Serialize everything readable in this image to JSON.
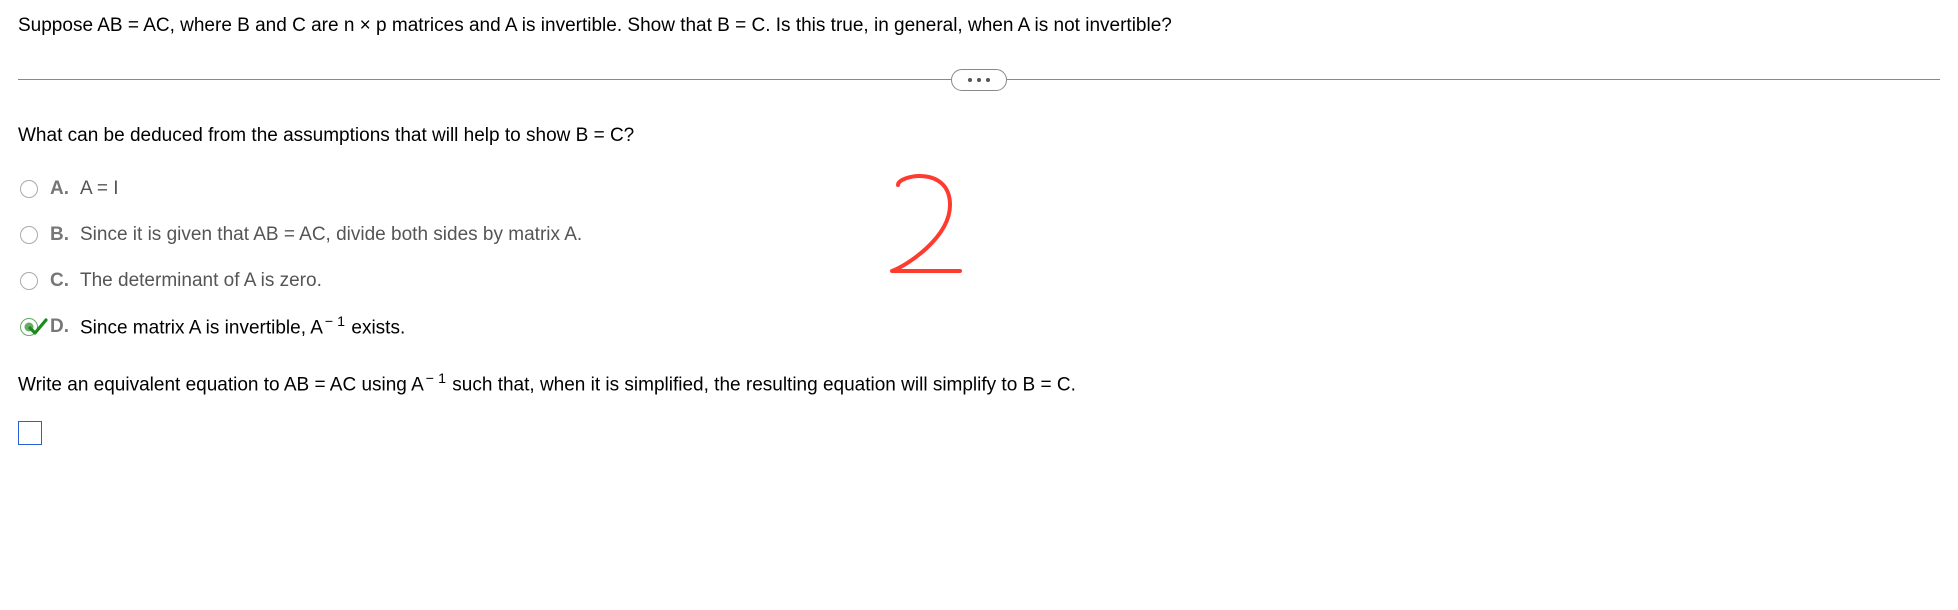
{
  "problem": "Suppose AB = AC, where B and C are n × p matrices and A is invertible. Show that B = C. Is this true, in general, when A is not invertible?",
  "question": "What can be deduced from the assumptions that will help to show B = C?",
  "options": {
    "a": {
      "letter": "A.",
      "text": "A = I"
    },
    "b": {
      "letter": "B.",
      "text": "Since it is given that AB = AC, divide both sides by matrix A."
    },
    "c": {
      "letter": "C.",
      "text": "The determinant of A is zero."
    },
    "d": {
      "letter": "D.",
      "text_pre": "Since matrix A is invertible, A",
      "sup": "− 1",
      "text_post": " exists."
    }
  },
  "followup": {
    "pre": "Write an equivalent equation to AB = AC using A",
    "sup": "− 1",
    "post": " such that, when it is simplified, the resulting equation will simplify to B = C."
  },
  "annotation_value": "2"
}
